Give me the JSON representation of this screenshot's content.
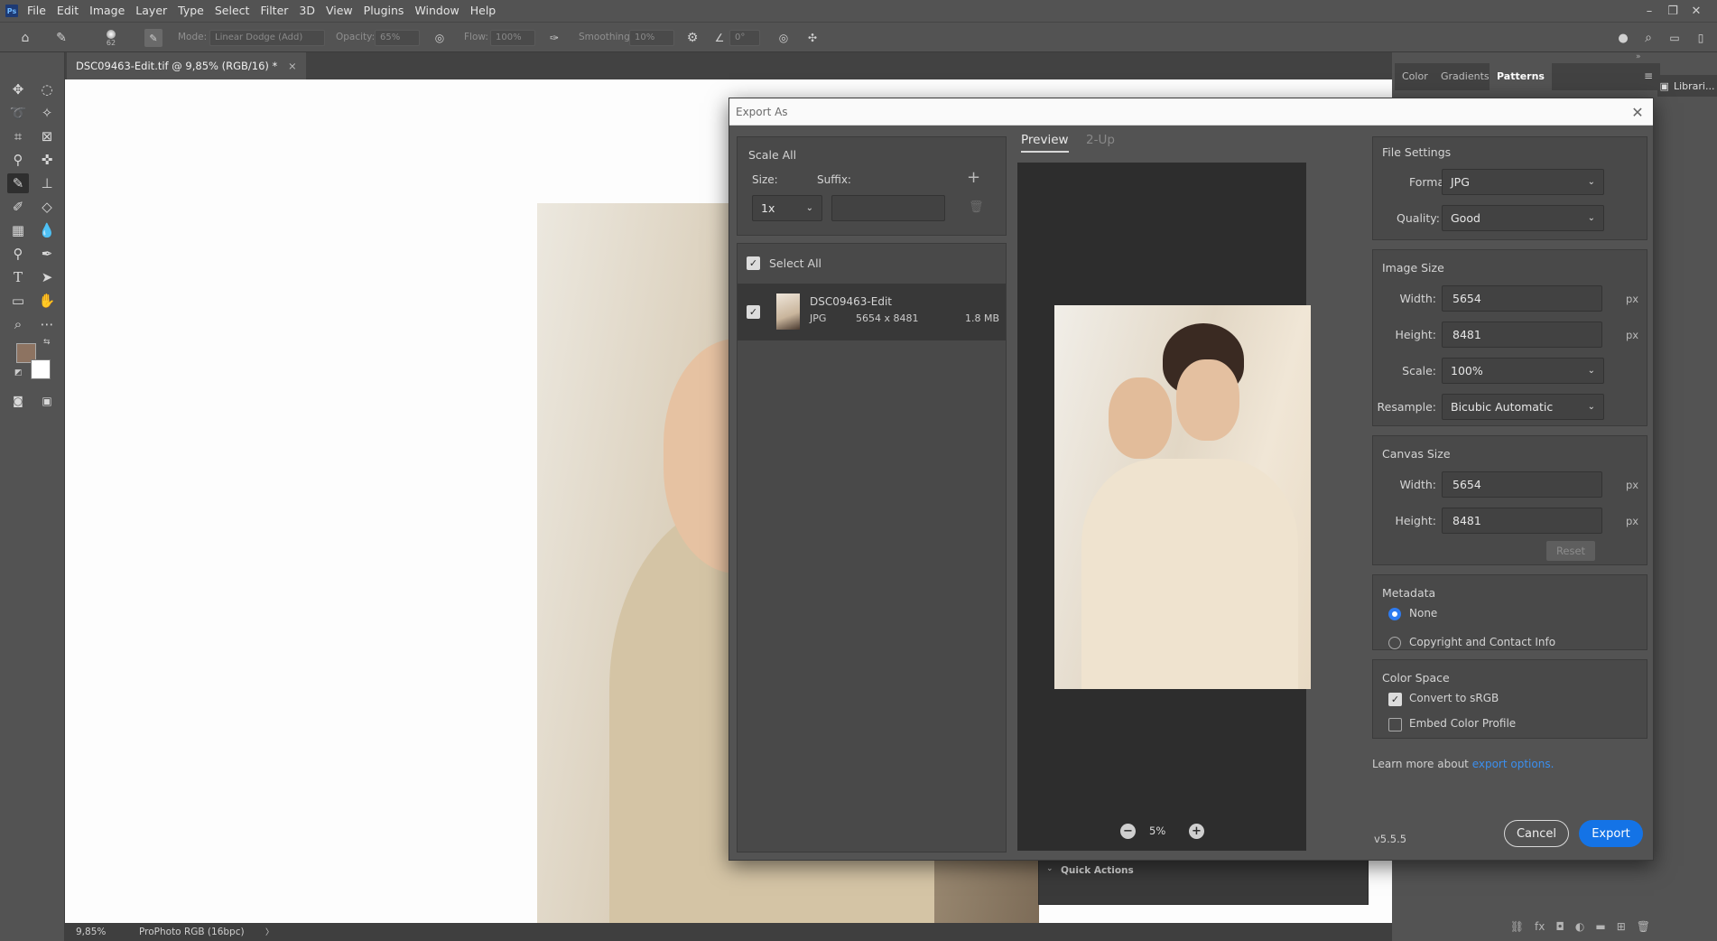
{
  "app": {
    "logo": "Ps",
    "menu": [
      "File",
      "Edit",
      "Image",
      "Layer",
      "Type",
      "Select",
      "Filter",
      "3D",
      "View",
      "Plugins",
      "Window",
      "Help"
    ],
    "window_controls": {
      "minimize": "–",
      "restore": "❐",
      "close": "✕"
    }
  },
  "options_bar": {
    "brush_size": "62",
    "mode_label": "Mode:",
    "mode_value": "Linear Dodge (Add)",
    "opacity_label": "Opacity:",
    "opacity_value": "65%",
    "flow_label": "Flow:",
    "flow_value": "100%",
    "smoothing_label": "Smoothing:",
    "smoothing_value": "10%",
    "angle_value": "0°"
  },
  "document_tab": {
    "title": "DSC09463-Edit.tif @ 9,85% (RGB/16) *",
    "close": "×"
  },
  "status_bar": {
    "zoom": "9,85%",
    "profile": "ProPhoto RGB (16bpc)",
    "arrow": "〉"
  },
  "right_panel": {
    "tabs": [
      "Color",
      "Gradients",
      "Patterns"
    ],
    "active_tab": "Patterns",
    "libraries_label": "Librari...",
    "quick_actions": "Quick Actions"
  },
  "colors": {
    "foreground": "#8d7361",
    "background": "#ffffff",
    "accent": "#1473e6",
    "radio_on": "#2e7bf0"
  },
  "dialog": {
    "title": "Export As",
    "scale_all": {
      "title": "Scale All",
      "size_label": "Size:",
      "suffix_label": "Suffix:",
      "size_value": "1x",
      "suffix_value": ""
    },
    "select_all": "Select All",
    "file_item": {
      "name": "DSC09463-Edit",
      "format": "JPG",
      "dimensions": "5654 x 8481",
      "filesize": "1.8 MB"
    },
    "preview": {
      "tab_preview": "Preview",
      "tab_2up": "2-Up",
      "zoom": "5%"
    },
    "file_settings": {
      "title": "File Settings",
      "format_label": "Format:",
      "format_value": "JPG",
      "quality_label": "Quality:",
      "quality_value": "Good"
    },
    "image_size": {
      "title": "Image Size",
      "width_label": "Width:",
      "width_value": "5654",
      "height_label": "Height:",
      "height_value": "8481",
      "unit": "px",
      "scale_label": "Scale:",
      "scale_value": "100%",
      "resample_label": "Resample:",
      "resample_value": "Bicubic Automatic"
    },
    "canvas_size": {
      "title": "Canvas Size",
      "width_label": "Width:",
      "width_value": "5654",
      "height_label": "Height:",
      "height_value": "8481",
      "unit": "px",
      "reset_label": "Reset"
    },
    "metadata": {
      "title": "Metadata",
      "none_label": "None",
      "copyright_label": "Copyright and Contact Info"
    },
    "color_space": {
      "title": "Color Space",
      "srgb_label": "Convert to sRGB",
      "embed_label": "Embed Color Profile"
    },
    "learn_more": {
      "text": "Learn more about ",
      "link": "export options."
    },
    "version": "v5.5.5",
    "cancel_label": "Cancel",
    "export_label": "Export"
  }
}
